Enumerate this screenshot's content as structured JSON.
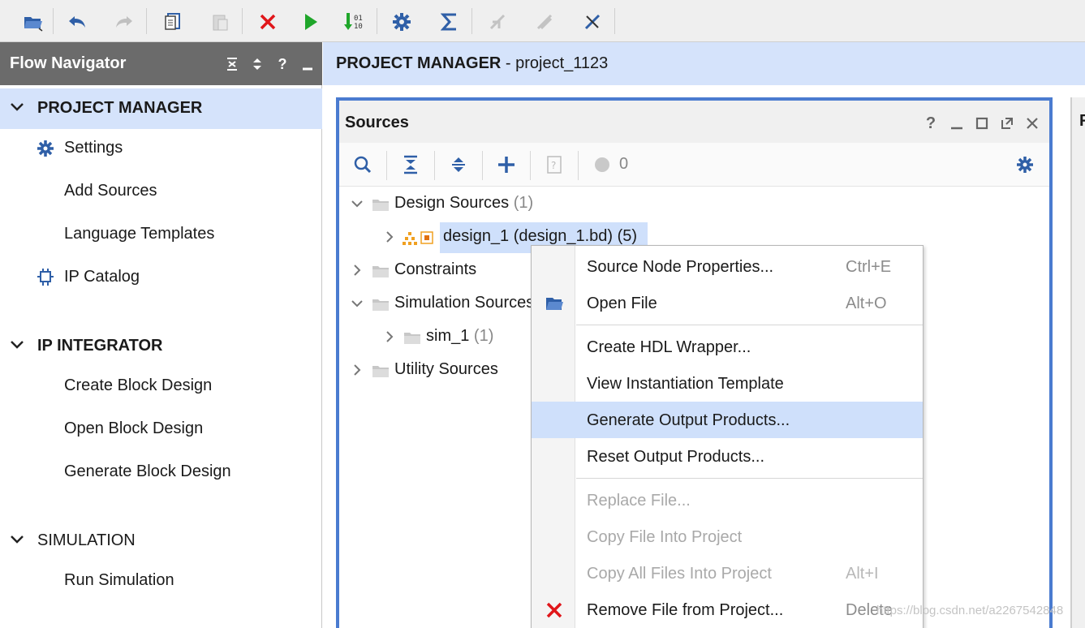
{
  "toolbar": {
    "icons": [
      "open-project-icon",
      "undo-icon",
      "redo-icon",
      "copy-icon",
      "paste-icon",
      "delete-icon",
      "run-icon",
      "bitstream-icon",
      "settings-icon",
      "sigma-icon",
      "auto-connect-icon",
      "disabled-tool-icon",
      "pin-tool-icon"
    ]
  },
  "flow_navigator": {
    "title": "Flow Navigator",
    "sections": [
      {
        "label": "PROJECT MANAGER",
        "items": [
          "Settings",
          "Add Sources",
          "Language Templates",
          "IP Catalog"
        ]
      },
      {
        "label": "IP INTEGRATOR",
        "items": [
          "Create Block Design",
          "Open Block Design",
          "Generate Block Design"
        ]
      },
      {
        "label": "SIMULATION",
        "items": [
          "Run Simulation"
        ]
      }
    ]
  },
  "main": {
    "title_bold": "PROJECT MANAGER",
    "title_rest": " - project_1123"
  },
  "sources": {
    "title": "Sources",
    "toolbar_count": "0",
    "tree": {
      "design_sources": "Design Sources",
      "design_sources_count": "(1)",
      "design_1": "design_1 (design_1.bd) (5)",
      "constraints": "Constraints",
      "simulation_sources": "Simulation Sources",
      "sim_1": "sim_1",
      "sim_1_count": "(1)",
      "utility_sources": "Utility Sources"
    }
  },
  "right_panel": {
    "label": "F"
  },
  "context_menu": {
    "items": [
      {
        "label": "Source Node Properties...",
        "shortcut": "Ctrl+E"
      },
      {
        "label": "Open File",
        "shortcut": "Alt+O"
      },
      {
        "label": "Create HDL Wrapper..."
      },
      {
        "label": "View Instantiation Template"
      },
      {
        "label": "Generate Output Products..."
      },
      {
        "label": "Reset Output Products..."
      },
      {
        "label": "Replace File..."
      },
      {
        "label": "Copy File Into Project"
      },
      {
        "label": "Copy All Files Into Project",
        "shortcut": "Alt+I"
      },
      {
        "label": "Remove File from Project...",
        "shortcut": "Delete"
      }
    ]
  },
  "watermark": "https://blog.csdn.net/a2267542848",
  "colors": {
    "selection": "#cfe0fb",
    "panel_border": "#4a7bd0",
    "nav_header": "#6b6b6b",
    "accent_icon": "#2f5fa7"
  }
}
